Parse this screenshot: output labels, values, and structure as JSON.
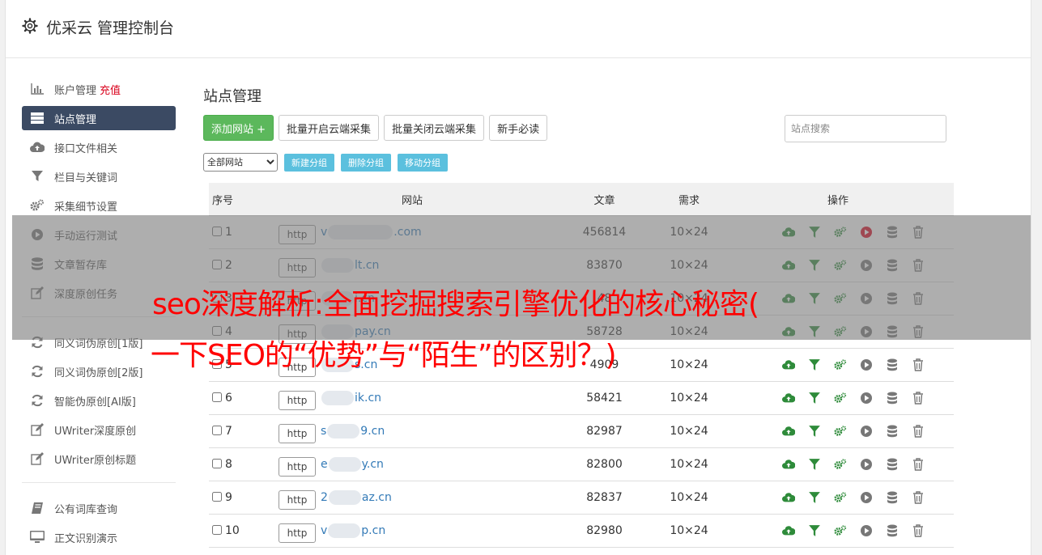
{
  "header": {
    "title": "优采云 管理控制台",
    "icon": "gear-icon"
  },
  "sidebar": {
    "groups": [
      [
        {
          "label": "账户管理",
          "badge": "充值",
          "icon": "bar-chart-icon"
        },
        {
          "label": "站点管理",
          "icon": "server-icon",
          "active": true
        },
        {
          "label": "接口文件相关",
          "icon": "cloud-upload-icon"
        },
        {
          "label": "栏目与关键词",
          "icon": "filter-icon"
        },
        {
          "label": "采集细节设置",
          "icon": "cogs-icon"
        },
        {
          "label": "手动运行测试",
          "icon": "play-icon"
        },
        {
          "label": "文章暂存库",
          "icon": "database-icon"
        },
        {
          "label": "深度原创任务",
          "icon": "edit-icon"
        }
      ],
      [
        {
          "label": "同义词伪原创[1版]",
          "icon": "refresh-icon"
        },
        {
          "label": "同义词伪原创[2版]",
          "icon": "refresh-icon"
        },
        {
          "label": "智能伪原创[AI版]",
          "icon": "refresh-icon"
        },
        {
          "label": "UWriter深度原创",
          "icon": "edit-icon"
        },
        {
          "label": "UWriter原创标题",
          "icon": "edit-icon"
        }
      ],
      [
        {
          "label": "公有词库查询",
          "icon": "book-icon"
        },
        {
          "label": "正文识别演示",
          "icon": "monitor-icon"
        }
      ]
    ]
  },
  "main": {
    "title": "站点管理",
    "toolbar": {
      "add_site": "添加网站 +",
      "batch_enable": "批量开启云端采集",
      "batch_disable": "批量关闭云端采集",
      "newbie": "新手必读"
    },
    "search": {
      "placeholder": "站点搜索"
    },
    "group_select": "全部网站",
    "group_buttons": {
      "new": "新建分组",
      "delete": "删除分组",
      "move": "移动分组"
    },
    "table": {
      "headers": {
        "no": "序号",
        "site": "网站",
        "articles": "文章",
        "demand": "需求",
        "ops": "操作"
      },
      "protocol_label": "http",
      "rows": [
        {
          "no": "1",
          "prefix": "v",
          "suffix": ".com",
          "articles": "456814",
          "demand": "10×24",
          "running": true
        },
        {
          "no": "2",
          "prefix": "",
          "suffix": "lt.cn",
          "articles": "83870",
          "demand": "10×24",
          "running": false
        },
        {
          "no": "3",
          "prefix": "",
          "suffix": "i.cn",
          "articles": "48",
          "demand": "10×24",
          "running": false
        },
        {
          "no": "4",
          "prefix": "",
          "suffix": "pay.cn",
          "articles": "58728",
          "demand": "10×24",
          "running": false
        },
        {
          "no": "5",
          "prefix": "",
          "suffix": "s.cn",
          "articles": "4909",
          "demand": "10×24",
          "running": false
        },
        {
          "no": "6",
          "prefix": "",
          "suffix": "ik.cn",
          "articles": "58421",
          "demand": "10×24",
          "running": false
        },
        {
          "no": "7",
          "prefix": "s",
          "suffix": "9.cn",
          "articles": "82987",
          "demand": "10×24",
          "running": false
        },
        {
          "no": "8",
          "prefix": "e",
          "suffix": "y.cn",
          "articles": "82800",
          "demand": "10×24",
          "running": false
        },
        {
          "no": "9",
          "prefix": "2",
          "suffix": "az.cn",
          "articles": "82837",
          "demand": "10×24",
          "running": false
        },
        {
          "no": "10",
          "prefix": "v",
          "suffix": "p.cn",
          "articles": "82980",
          "demand": "10×24",
          "running": false
        }
      ]
    }
  },
  "overlay": {
    "line1": "seo深度解析:全面挖掘搜索引擎优化的核心秘密(",
    "line2": "一下SEO的“优势”与“陌生”的区别？)"
  },
  "colors": {
    "active_nav": "#3b4a63",
    "green": "#5cb85c",
    "info": "#5bc0de",
    "link": "#337ab7",
    "danger": "#d9001b",
    "overlay_text": "#ff0000"
  }
}
